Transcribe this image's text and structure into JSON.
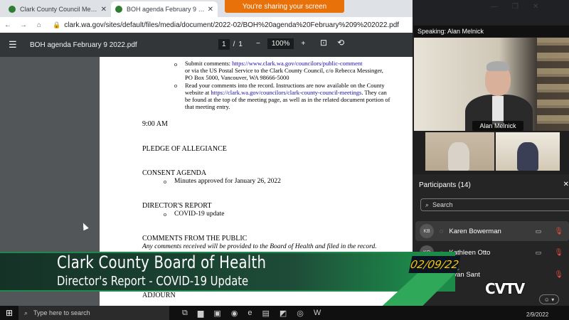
{
  "browser": {
    "tabs": [
      {
        "label": "Clark County Council Meetings | C",
        "close": "✕"
      },
      {
        "label": "BOH agenda February 9 2022.pdf",
        "close": "✕"
      }
    ],
    "sharing_banner": "You're sharing your screen",
    "url": "clark.wa.gov/sites/default/files/media/document/2022-02/BOH%20agenda%20February%209%202022.pdf"
  },
  "pdf": {
    "title": "BOH agenda February 9 2022.pdf",
    "page_current": "1",
    "page_separator": "/",
    "page_total": "1",
    "zoom": "100%",
    "content": {
      "bullet1_pre": "Submit comments: ",
      "bullet1_link": "https://www.clark.wa.gov/councilors/public-comment",
      "bullet1_line2": "or via the US Postal Service to the Clark County Council, c/o Rebecca Messinger,",
      "bullet1_line3": "PO Box 5000, Vancouver, WA 98666-5000",
      "bullet2_line1": "Read your comments into the record. Instructions are now available on the County",
      "bullet2_pre": "website at ",
      "bullet2_link": "https://clark.wa.gov/councilors/clark-county-council-meetings",
      "bullet2_post": ". They can",
      "bullet2_line3": "be found at the top of the meeting page, as well as in the related document portion of",
      "bullet2_line4": "that meeting entry.",
      "time": "9:00 AM",
      "pledge": "PLEDGE OF ALLEGIANCE",
      "consent": "CONSENT AGENDA",
      "consent_item": "Minutes approved for January 26, 2022",
      "director": "DIRECTOR'S REPORT",
      "director_item": "COVID-19 update",
      "comments": "COMMENTS FROM THE PUBLIC",
      "comments_note": "Any comments received will be provided to the Board of Health and filed in the record.",
      "adjourn": "ADJOURN",
      "bullet_glyph": "o"
    }
  },
  "call": {
    "speaking_label": "Speaking: Alan Melnick",
    "main_name": "Alan Melnick",
    "participants_header": "Participants (14)",
    "search_placeholder": "Search",
    "participants": [
      {
        "initials": "KB",
        "name": "Karen Bowerman"
      },
      {
        "initials": "KO",
        "name": "Kathleen Otto"
      },
      {
        "initials": "",
        "name": "nea Van Sant"
      }
    ]
  },
  "overlay": {
    "title": "Clark County Board of Health",
    "subtitle": "Director's Report - COVID-19 Update",
    "date": "02/09/22",
    "logo": "CVTV"
  },
  "taskbar": {
    "search_placeholder": "Type here to search",
    "date": "2/9/2022"
  },
  "colors": {
    "overlay_green": "#1d8a4a",
    "date_yellow": "#f6c40a",
    "share_orange": "#e8710a",
    "link_blue": "#1a0dab"
  }
}
